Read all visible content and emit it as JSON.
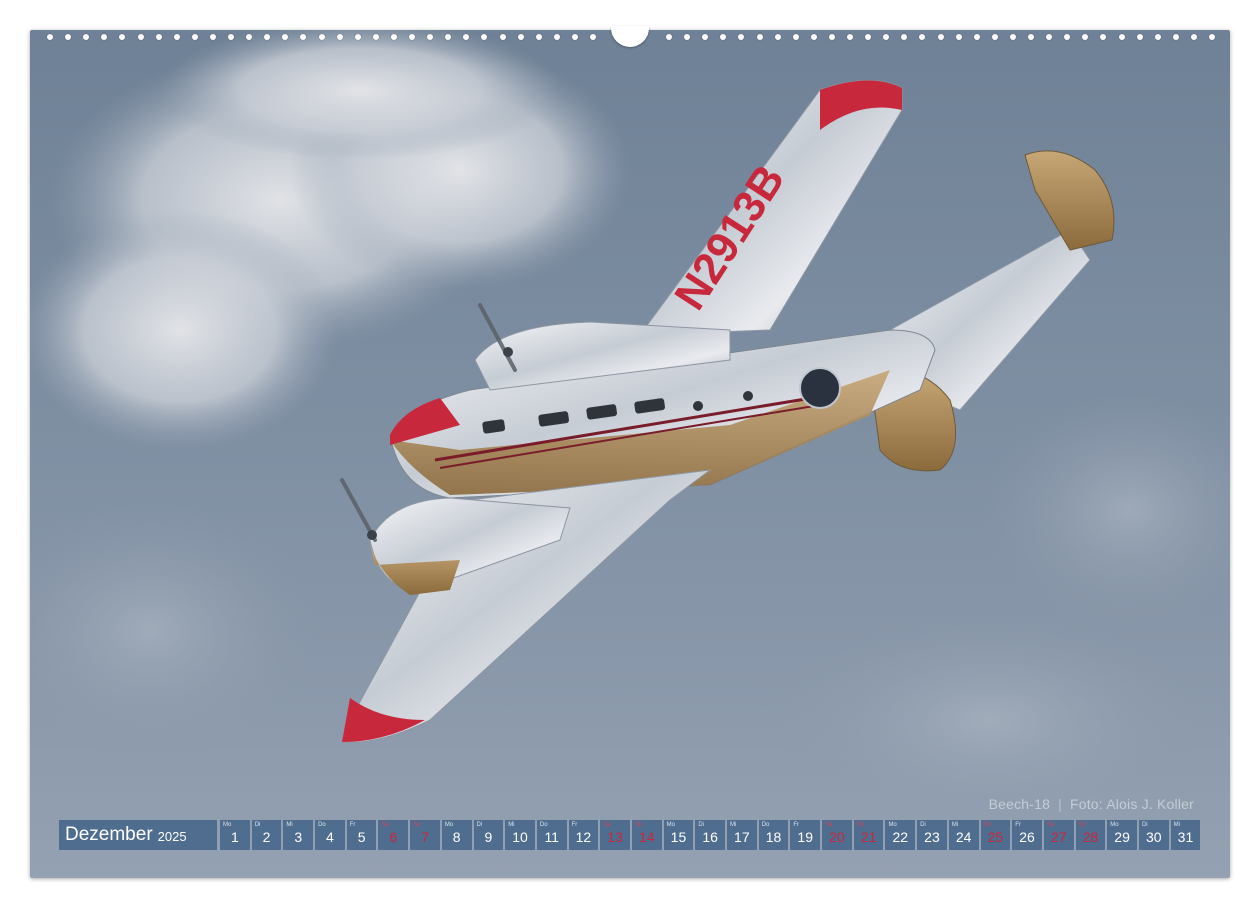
{
  "calendar": {
    "month": "Dezember",
    "year": "2025",
    "days": [
      {
        "wd": "Mo",
        "num": "1",
        "weekend": false
      },
      {
        "wd": "Di",
        "num": "2",
        "weekend": false
      },
      {
        "wd": "Mi",
        "num": "3",
        "weekend": false
      },
      {
        "wd": "Do",
        "num": "4",
        "weekend": false
      },
      {
        "wd": "Fr",
        "num": "5",
        "weekend": false
      },
      {
        "wd": "Sa",
        "num": "6",
        "weekend": true
      },
      {
        "wd": "So",
        "num": "7",
        "weekend": true
      },
      {
        "wd": "Mo",
        "num": "8",
        "weekend": false
      },
      {
        "wd": "Di",
        "num": "9",
        "weekend": false
      },
      {
        "wd": "Mi",
        "num": "10",
        "weekend": false
      },
      {
        "wd": "Do",
        "num": "11",
        "weekend": false
      },
      {
        "wd": "Fr",
        "num": "12",
        "weekend": false
      },
      {
        "wd": "Sa",
        "num": "13",
        "weekend": true
      },
      {
        "wd": "So",
        "num": "14",
        "weekend": true
      },
      {
        "wd": "Mo",
        "num": "15",
        "weekend": false
      },
      {
        "wd": "Di",
        "num": "16",
        "weekend": false
      },
      {
        "wd": "Mi",
        "num": "17",
        "weekend": false
      },
      {
        "wd": "Do",
        "num": "18",
        "weekend": false
      },
      {
        "wd": "Fr",
        "num": "19",
        "weekend": false
      },
      {
        "wd": "Sa",
        "num": "20",
        "weekend": true
      },
      {
        "wd": "So",
        "num": "21",
        "weekend": true
      },
      {
        "wd": "Mo",
        "num": "22",
        "weekend": false
      },
      {
        "wd": "Di",
        "num": "23",
        "weekend": false
      },
      {
        "wd": "Mi",
        "num": "24",
        "weekend": false
      },
      {
        "wd": "Do",
        "num": "25",
        "weekend": true
      },
      {
        "wd": "Fr",
        "num": "26",
        "weekend": false
      },
      {
        "wd": "Sa",
        "num": "27",
        "weekend": true
      },
      {
        "wd": "So",
        "num": "28",
        "weekend": true
      },
      {
        "wd": "Mo",
        "num": "29",
        "weekend": false
      },
      {
        "wd": "Di",
        "num": "30",
        "weekend": false
      },
      {
        "wd": "Mi",
        "num": "31",
        "weekend": false
      }
    ]
  },
  "caption": {
    "subject": "Beech-18",
    "separator": "|",
    "credit": "Foto: Alois J. Koller"
  },
  "aircraft": {
    "registration": "N2913B"
  },
  "colors": {
    "sky": "#7b8ca0",
    "calendar_bar": "#4a688c",
    "weekend_red": "#c8283c",
    "aircraft_red": "#c8283c"
  }
}
